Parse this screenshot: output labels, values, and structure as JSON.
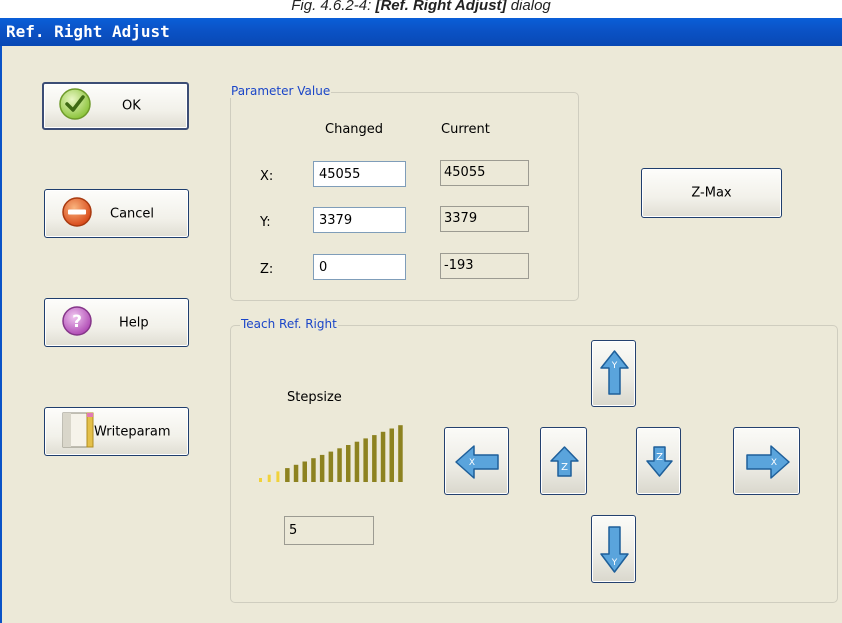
{
  "caption": {
    "prefix": "Fig. 4.6.2-4: ",
    "bold": "[Ref. Right Adjust]",
    "suffix": " dialog"
  },
  "window": {
    "title": "Ref. Right Adjust"
  },
  "buttons": {
    "ok": "OK",
    "cancel": "Cancel",
    "help": "Help",
    "writeparam": "Writeparam",
    "zmax": "Z-Max"
  },
  "parameter_value": {
    "legend": "Parameter Value",
    "col_changed": "Changed",
    "col_current": "Current",
    "rows": [
      {
        "label": "X:",
        "changed": "45055",
        "current": "45055"
      },
      {
        "label": "Y:",
        "changed": "3379",
        "current": "3379"
      },
      {
        "label": "Z:",
        "changed": "0",
        "current": "-193"
      }
    ]
  },
  "teach": {
    "legend": "Teach Ref. Right",
    "stepsize_label": "Stepsize",
    "stepsize_value": "5"
  },
  "colors": {
    "title_bar": "#0b53c7",
    "legend_text": "#1b46c8",
    "window_bg": "#ece9d8",
    "stepsize_bars": "#8d8220",
    "arrow_blue": "#4a9ad6"
  }
}
